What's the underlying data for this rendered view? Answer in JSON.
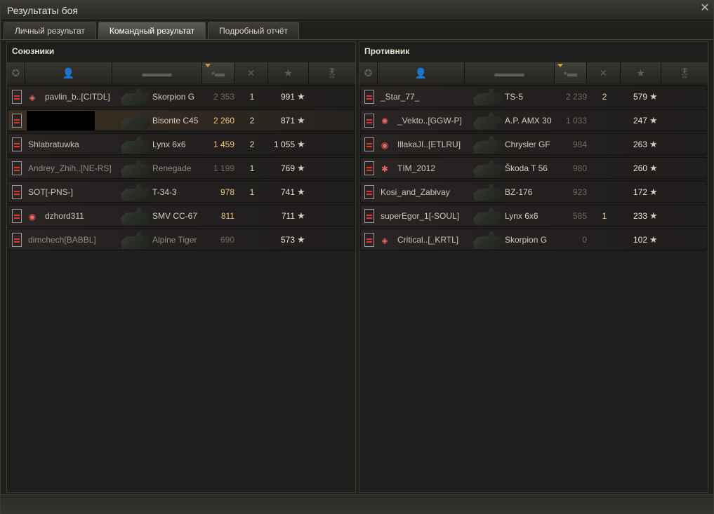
{
  "window": {
    "title": "Результаты боя"
  },
  "tabs": [
    {
      "label": "Личный результат",
      "active": false
    },
    {
      "label": "Командный результат",
      "active": true
    },
    {
      "label": "Подробный отчёт",
      "active": false
    }
  ],
  "allies": {
    "title": "Союзники",
    "rows": [
      {
        "name": "pavlin_b..[CITDL]",
        "clan_icon": "diamond-icon",
        "vehicle": "Skorpion G",
        "damage": "2 353",
        "frags": "1",
        "xp": "991",
        "dim_name": false,
        "dim_damage": true
      },
      {
        "name": "",
        "redacted": true,
        "vehicle": "Bisonte C45",
        "damage": "2 260",
        "frags": "2",
        "xp": "871",
        "self": true
      },
      {
        "name": "Shlabratuwka",
        "vehicle": "Lynx 6x6",
        "damage": "1 459",
        "frags": "2",
        "xp": "1 055"
      },
      {
        "name": "Andrey_Zhih..[NE-RS]",
        "vehicle": "Renegade",
        "damage": "1 199",
        "frags": "1",
        "xp": "769",
        "dim_name": true,
        "dim_vehicle": true,
        "dim_damage": true
      },
      {
        "name": "SOT[-PNS-]",
        "vehicle": "T-34-3",
        "damage": "978",
        "frags": "1",
        "xp": "741"
      },
      {
        "name": "dzhord311",
        "clan_icon": "eye-emblem-icon",
        "vehicle": "SMV CC-67",
        "damage": "811",
        "frags": "",
        "xp": "711"
      },
      {
        "name": "dimchech[BABBL]",
        "vehicle": "Alpine Tiger",
        "damage": "690",
        "frags": "",
        "xp": "573",
        "dim_name": true,
        "dim_vehicle": true,
        "dim_damage": true
      }
    ]
  },
  "enemies": {
    "title": "Противник",
    "rows": [
      {
        "name": "_Star_77_",
        "vehicle": "TS-5",
        "damage": "2 239",
        "frags": "2",
        "xp": "579",
        "dim_damage": true
      },
      {
        "name": "_Vekto..[GGW-P]",
        "clan_icon": "laurel-emblem-icon",
        "vehicle": "A.P. AMX 30",
        "damage": "1 033",
        "frags": "",
        "xp": "247",
        "dim_damage": true
      },
      {
        "name": "IllakaJI..[ETLRU]",
        "clan_icon": "eye-emblem-icon",
        "vehicle": "Chrysler GF",
        "damage": "984",
        "frags": "",
        "xp": "263",
        "dim_damage": true
      },
      {
        "name": "TIM_2012",
        "clan_icon": "spider-emblem-icon",
        "vehicle": "Škoda T 56",
        "damage": "980",
        "frags": "",
        "xp": "260",
        "dim_damage": true
      },
      {
        "name": "Kosi_and_Zabivay",
        "vehicle": "BZ-176",
        "damage": "923",
        "frags": "",
        "xp": "172",
        "dim_damage": true
      },
      {
        "name": "superEgor_1[-SOUL]",
        "vehicle": "Lynx 6x6",
        "damage": "585",
        "frags": "1",
        "xp": "233",
        "dim_damage": true
      },
      {
        "name": "Critical..[_KRTL]",
        "clan_icon": "diamond-icon",
        "vehicle": "Skorpion G",
        "damage": "0",
        "frags": "",
        "xp": "102",
        "dim_damage": true
      }
    ]
  },
  "icons": {
    "close": "close-icon",
    "sort_arrow": "sort-desc-icon",
    "star": "star-icon"
  }
}
